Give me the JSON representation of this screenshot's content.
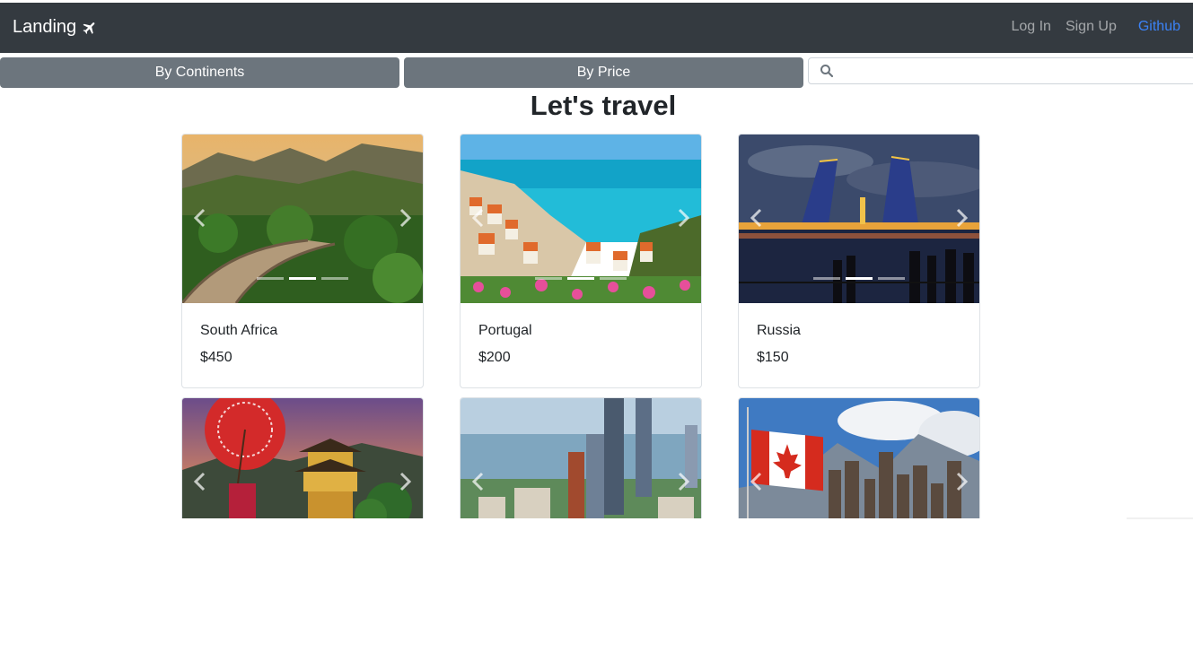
{
  "navbar": {
    "brand": "Landing",
    "brand_icon": "plane-icon",
    "links": {
      "login": "Log In",
      "signup": "Sign Up",
      "github": "Github"
    }
  },
  "filters": {
    "continents": "By Continents",
    "price": "By Price"
  },
  "search": {
    "placeholder": "",
    "icon": "search-icon"
  },
  "heading": "Let's travel",
  "cards": [
    {
      "name": "South Africa",
      "price": "$450"
    },
    {
      "name": "Portugal",
      "price": "$200"
    },
    {
      "name": "Russia",
      "price": "$150"
    },
    {
      "name": "",
      "price": ""
    },
    {
      "name": "",
      "price": ""
    },
    {
      "name": "",
      "price": ""
    }
  ],
  "colors": {
    "navbar": "#343a40",
    "button": "#6c757d",
    "github_link": "#3b82f6"
  }
}
